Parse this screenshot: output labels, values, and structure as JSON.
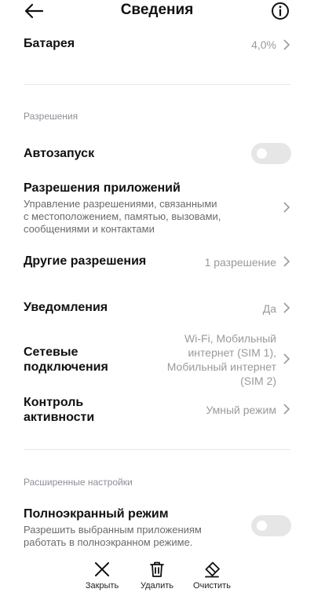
{
  "header": {
    "title": "Сведения",
    "back_icon": "arrow-left-icon",
    "info_icon": "info-circle-icon"
  },
  "battery": {
    "label": "Батарея",
    "value": "4,0%"
  },
  "permissions_section": {
    "label": "Разрешения",
    "autostart": {
      "label": "Автозапуск",
      "enabled": false
    },
    "app_permissions": {
      "label": "Разрешения приложений",
      "description": [
        "Управление разрешениями, связанными",
        "с местоположением, памятью, вызовами,",
        "сообщениями и контактами"
      ]
    },
    "other_permissions": {
      "label": "Другие разрешения",
      "value": "1 разрешение"
    },
    "notifications": {
      "label": "Уведомления",
      "value": "Да"
    },
    "network": {
      "label": [
        "Сетевые",
        "подключения"
      ],
      "value": [
        "Wi-Fi, Мобильный",
        "интернет (SIM 1),",
        "Мобильный интернет",
        "(SIM 2)"
      ]
    },
    "activity_control": {
      "label": [
        "Контроль",
        "активности"
      ],
      "value": "Умный режим"
    }
  },
  "advanced_section": {
    "label": "Расширенные настройки",
    "fullscreen": {
      "label": "Полноэкранный режим",
      "description": [
        "Разрешить выбранным приложениям",
        "работать в полноэкранном режиме."
      ],
      "enabled": false
    }
  },
  "bottom_bar": {
    "close": {
      "label": "Закрыть",
      "icon": "close-x-icon"
    },
    "delete": {
      "label": "Удалить",
      "icon": "trash-icon"
    },
    "clear": {
      "label": "Очистить",
      "icon": "eraser-icon"
    }
  }
}
